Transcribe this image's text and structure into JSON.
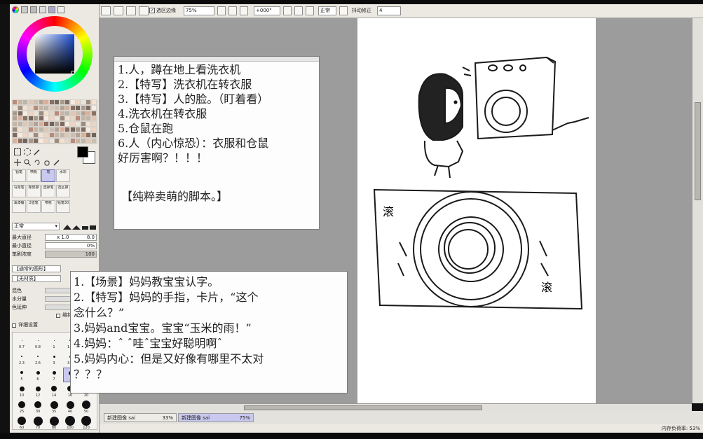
{
  "toolbar": {
    "selection_edge_label": "选区边缘",
    "zoom_value": "75%",
    "rotation_value": "+000°",
    "blend_mode": "正常",
    "stabilizer_label": "抖动修正",
    "stabilizer_value": "4"
  },
  "left_panel": {
    "brushes": [
      "铅笔",
      "喷枪",
      "笔",
      "水彩",
      "马克笔",
      "橡皮擦",
      "选择笔",
      "选区擦",
      "油漆桶",
      "2值笔",
      "喷枪",
      "铅笔30"
    ],
    "blend_mode": "正常",
    "max_size_label": "最大直径",
    "max_size_mult": "x 1.0",
    "max_size_value": "8.0",
    "min_size_label": "最小直径",
    "min_size_value": "0%",
    "density_label": "笔刷浓度",
    "density_value": "100",
    "shape_label": "【通常的圆形】",
    "texture_label": "【无材质】",
    "mix_label": "混色",
    "water_label": "水分量",
    "color_extend_label": "色延伸",
    "keep_opacity_label": "维持不",
    "detail_label": "详细设置",
    "sizes_row1": [
      "0.7",
      "0.8",
      "1",
      "1.5",
      "2"
    ],
    "sizes_row2": [
      "2.3",
      "2.6",
      "3",
      "3.5",
      "4"
    ],
    "sizes_row3": [
      "5",
      "6",
      "7",
      "8",
      "9"
    ],
    "sizes_row4": [
      "10",
      "12",
      "14",
      "16",
      "20"
    ],
    "sizes_row5": [
      "25",
      "30",
      "35",
      "40",
      "50"
    ],
    "sizes_row6": [
      "60",
      "70",
      "80",
      "100",
      "120"
    ]
  },
  "note1": {
    "lines": [
      "1.人，蹲在地上看洗衣机",
      "2.【特写】洗衣机在转衣服",
      "3.【特写】人的脸。（盯着看）",
      "4.洗衣机在转衣服",
      "5.仓鼠在跑",
      "6.人（内心惊恐）：衣服和仓鼠",
      "好厉害啊？！！！"
    ],
    "footer": "【纯粹卖萌的脚本。】"
  },
  "note2": {
    "lines": [
      "1.【场景】妈妈教宝宝认字。",
      "2.【特写】妈妈的手指，卡片，“这个",
      "念什么？”",
      "3.妈妈and宝宝。宝宝“玉米的雨！”",
      "4.妈妈：ˆ ˆ哇ˆ宝宝好聪明啊ˆ",
      "5.妈妈内心：但是又好像有哪里不太对",
      "？？？"
    ]
  },
  "canvas": {
    "sfx_left": "滚",
    "sfx_right": "滚"
  },
  "tabs": [
    {
      "label": "新建图像 sai",
      "zoom": "33%"
    },
    {
      "label": "新建图像 sai",
      "zoom": "75%"
    }
  ],
  "status": {
    "memory_label": "内存负荷率: 53%"
  },
  "colors": {
    "panel_bg": "#ece9e2",
    "canvas_bg": "#9c9c9c",
    "active_tab": "#c9c9ef"
  }
}
